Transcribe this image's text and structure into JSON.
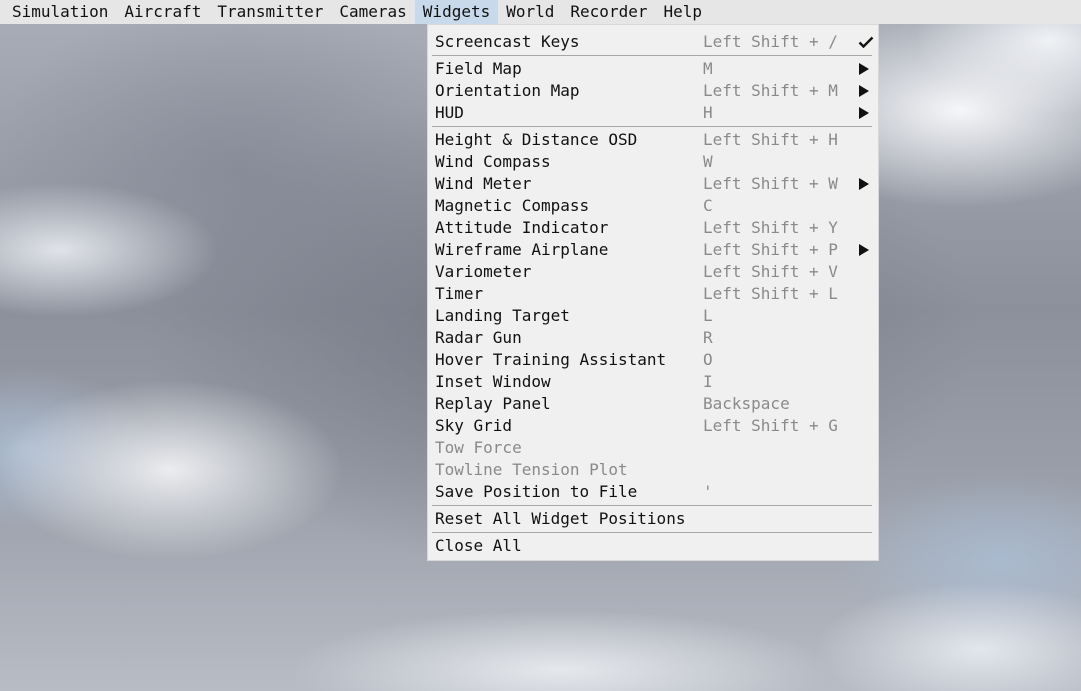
{
  "menubar": {
    "items": [
      {
        "label": "Simulation"
      },
      {
        "label": "Aircraft"
      },
      {
        "label": "Transmitter"
      },
      {
        "label": "Cameras"
      },
      {
        "label": "Widgets",
        "active": true
      },
      {
        "label": "World"
      },
      {
        "label": "Recorder"
      },
      {
        "label": "Help"
      }
    ]
  },
  "widgets_menu": {
    "items": [
      {
        "label": "Screencast Keys",
        "shortcut": "Left Shift + /",
        "checked": true
      },
      {
        "separator": true
      },
      {
        "label": "Field Map",
        "shortcut": "M",
        "submenu": true
      },
      {
        "label": "Orientation Map",
        "shortcut": "Left Shift + M",
        "submenu": true
      },
      {
        "label": "HUD",
        "shortcut": "H",
        "submenu": true
      },
      {
        "separator": true
      },
      {
        "label": "Height & Distance OSD",
        "shortcut": "Left Shift + H"
      },
      {
        "label": "Wind Compass",
        "shortcut": "W"
      },
      {
        "label": "Wind Meter",
        "shortcut": "Left Shift + W",
        "submenu": true
      },
      {
        "label": "Magnetic Compass",
        "shortcut": "C"
      },
      {
        "label": "Attitude Indicator",
        "shortcut": "Left Shift + Y"
      },
      {
        "label": "Wireframe Airplane",
        "shortcut": "Left Shift + P",
        "submenu": true
      },
      {
        "label": "Variometer",
        "shortcut": "Left Shift + V"
      },
      {
        "label": "Timer",
        "shortcut": "Left Shift + L"
      },
      {
        "label": "Landing Target",
        "shortcut": "L"
      },
      {
        "label": "Radar Gun",
        "shortcut": "R"
      },
      {
        "label": "Hover Training Assistant",
        "shortcut": "O"
      },
      {
        "label": "Inset Window",
        "shortcut": "I"
      },
      {
        "label": "Replay Panel",
        "shortcut": "Backspace"
      },
      {
        "label": "Sky Grid",
        "shortcut": "Left Shift + G"
      },
      {
        "label": "Tow Force",
        "disabled": true
      },
      {
        "label": "Towline Tension Plot",
        "disabled": true
      },
      {
        "label": "Save Position to File",
        "shortcut": "'"
      },
      {
        "separator": true
      },
      {
        "label": "Reset All Widget Positions"
      },
      {
        "separator": true
      },
      {
        "label": "Close All"
      }
    ]
  },
  "icons": {
    "check": "checkmark-icon",
    "submenu": "submenu-arrow-icon"
  },
  "colors": {
    "menubar_bg": "#e6e6e6",
    "menubar_active": "#c7d9ea",
    "menu_bg": "#f0f0f0",
    "shortcut_text": "#8a8a8a"
  }
}
